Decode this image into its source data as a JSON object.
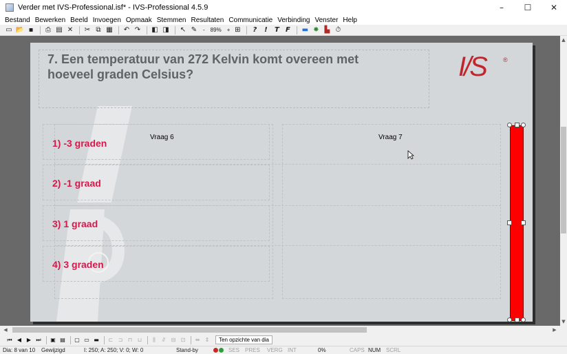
{
  "window": {
    "title": "Verder met IVS-Professional.isf* - IVS-Professional 4.5.9",
    "minimize": "–",
    "maximize": "☐",
    "close": "✕"
  },
  "menu": [
    "Bestand",
    "Bewerken",
    "Beeld",
    "Invoegen",
    "Opmaak",
    "Stemmen",
    "Resultaten",
    "Communicatie",
    "Verbinding",
    "Venster",
    "Help"
  ],
  "toolbar": {
    "zoom_minus": "-",
    "zoom": "89%",
    "zoom_plus": "+",
    "format_chars": [
      "?",
      "!",
      "T",
      "F"
    ]
  },
  "slide": {
    "question": "7. Een temperatuur van 272 Kelvin komt overeen met hoeveel graden Celsius?",
    "logo": "IVS",
    "logo_mark": "®",
    "answers": [
      "1) -3 graden",
      "2) -1 graad",
      "3) 1 graad",
      "4) 3 graden"
    ],
    "columns": [
      "Vraag 6",
      "Vraag 7"
    ]
  },
  "navbar": {
    "button_label": "Ten opzichte van dia"
  },
  "status": {
    "slide": "Dia: 8 van 10",
    "modified": "Gewijzigd",
    "counts": "I: 250;   A: 250;   V: 0;   W: 0",
    "mode": "Stand-by",
    "ses": "SES",
    "pres": "PRES",
    "verg": "VERG",
    "int": "INT",
    "percent": "0%",
    "caps": "CAPS",
    "num": "NUM",
    "scrl": "SCRL"
  },
  "colors": {
    "answer_text": "#d6194a",
    "question_text": "#5f6366",
    "bar": "#ff0000",
    "logo": "#c0262c"
  }
}
